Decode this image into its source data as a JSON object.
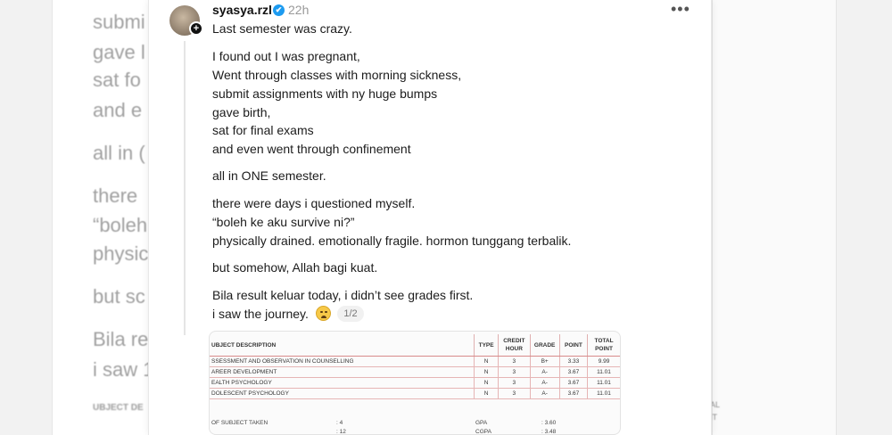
{
  "background": {
    "lines": [
      "submi",
      "gave l",
      "sat fo",
      "and e",
      "all in (",
      "there",
      "“boleh",
      "physic",
      "but sc",
      "Bila re",
      "i saw 1"
    ],
    "table_header": "UBJECT DE",
    "right_tag": [
      "AL",
      "IT"
    ]
  },
  "post": {
    "username": "syasya.rzl",
    "verified_mark": "✔",
    "time": "22h",
    "more_label": "•••",
    "follow_plus": "+",
    "lines": [
      "Last semester was crazy.",
      "I found out I was pregnant,",
      "Went through classes with morning sickness,",
      "submit assignments with ny huge bumps",
      "gave birth,",
      "sat for final exams",
      "and even went through confinement",
      "all in ONE semester.",
      "there were days i questioned myself.",
      "“boleh ke aku survive ni?”",
      "physically drained. emotionally fragile. hormon tunggang terbalik.",
      "but somehow, Allah bagi kuat.",
      "Bila result keluar today, i didn’t see grades first.",
      "i saw the journey."
    ],
    "emoji_name": "crying-face-icon",
    "pager": "1/2"
  },
  "result": {
    "headers": [
      "UBJECT DESCRIPTION",
      "TYPE",
      "CREDIT HOUR",
      "GRADE",
      "POINT",
      "TOTAL POINT"
    ],
    "rows": [
      [
        "SSESSMENT AND OBSERVATION IN COUNSELLING",
        "N",
        "3",
        "B+",
        "3.33",
        "9.99"
      ],
      [
        "AREER DEVELOPMENT",
        "N",
        "3",
        "A-",
        "3.67",
        "11.01"
      ],
      [
        "EALTH PSYCHOLOGY",
        "N",
        "3",
        "A-",
        "3.67",
        "11.01"
      ],
      [
        "DOLESCENT PSYCHOLOGY",
        "N",
        "3",
        "A-",
        "3.67",
        "11.01"
      ]
    ],
    "summary": {
      "subjects_label": "OF SUBJECT TAKEN",
      "subjects_value": ": 4",
      "credit_value": ": 12",
      "gpa_label": "GPA",
      "gpa_value": ": 3.60",
      "cgpa_label": "CGPA",
      "cgpa_value": ": 3.48"
    }
  },
  "colors": {
    "verified": "#1d9bf0",
    "table_rule": "#d88a8a"
  }
}
